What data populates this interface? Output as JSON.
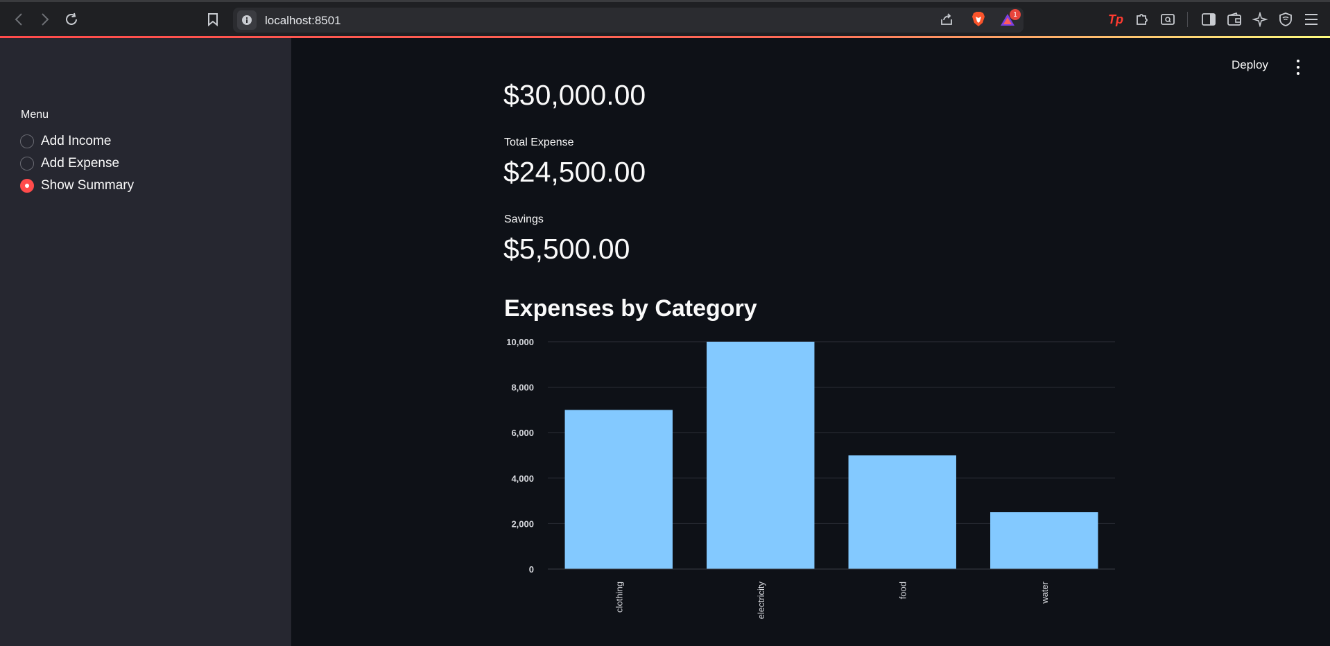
{
  "browser": {
    "url": "localhost:8501",
    "notification_count": "1"
  },
  "sidebar": {
    "menu_title": "Menu",
    "options": [
      {
        "label": "Add Income",
        "selected": false
      },
      {
        "label": "Add Expense",
        "selected": false
      },
      {
        "label": "Show Summary",
        "selected": true
      }
    ]
  },
  "header": {
    "deploy_label": "Deploy"
  },
  "metrics": {
    "total_income_value": "$30,000.00",
    "total_expense_label": "Total Expense",
    "total_expense_value": "$24,500.00",
    "savings_label": "Savings",
    "savings_value": "$5,500.00"
  },
  "chart_title": "Expenses by Category",
  "colors": {
    "accent": "#ff4b4b",
    "bar": "#83c9ff",
    "background": "#0e1117",
    "sidebar": "#262730"
  },
  "chart_data": {
    "type": "bar",
    "categories": [
      "clothing",
      "electricity",
      "food",
      "water"
    ],
    "values": [
      7000,
      10000,
      5000,
      2500
    ],
    "ylim": [
      0,
      10000
    ],
    "yticks": [
      0,
      2000,
      4000,
      6000,
      8000,
      10000
    ],
    "ytick_labels": [
      "0",
      "2,000",
      "4,000",
      "6,000",
      "8,000",
      "10,000"
    ],
    "grid": true,
    "xlabel": "",
    "ylabel": ""
  }
}
